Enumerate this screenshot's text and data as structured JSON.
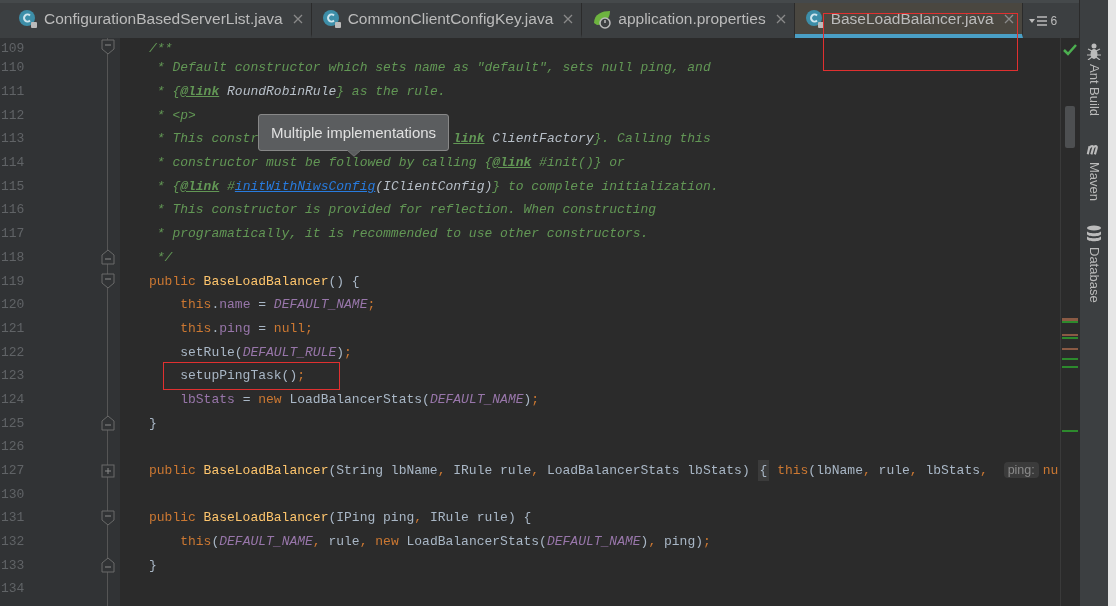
{
  "tabs": [
    {
      "label": "ConfigurationBasedServerList.java",
      "kind": "class",
      "selected": false
    },
    {
      "label": "CommonClientConfigKey.java",
      "kind": "class",
      "selected": false
    },
    {
      "label": "application.properties",
      "kind": "spring",
      "selected": false
    },
    {
      "label": "BaseLoadBalancer.java",
      "kind": "class",
      "selected": true
    }
  ],
  "tab_overflow": {
    "count": "6"
  },
  "tooltip": {
    "text": "Multiple implementations"
  },
  "code_lines": [
    {
      "number": "109",
      "kind": "fold_open",
      "tokens": [
        {
          "kind": "comment",
          "text": "/**"
        }
      ]
    },
    {
      "number": "110",
      "tokens": [
        {
          "kind": "comment",
          "text": " * Default constructor which sets name as \"default\", sets null ping, and"
        }
      ]
    },
    {
      "number": "111",
      "tokens": [
        {
          "kind": "comment",
          "text": " * {"
        },
        {
          "kind": "tag",
          "text": "@link"
        },
        {
          "kind": "ref",
          "text": " RoundRobinRule"
        },
        {
          "kind": "comment",
          "text": "} as the rule."
        }
      ]
    },
    {
      "number": "112",
      "tokens": [
        {
          "kind": "comment",
          "text": " * <p>"
        }
      ]
    },
    {
      "number": "113",
      "tokens": [
        {
          "kind": "comment",
          "text": " * This constr"
        },
        {
          "kind": "covered"
        },
        {
          "kind": "tag",
          "text": "link"
        },
        {
          "kind": "ref",
          "text": " ClientFactory"
        },
        {
          "kind": "comment",
          "text": "}. Calling this"
        }
      ]
    },
    {
      "number": "114",
      "tokens": [
        {
          "kind": "comment",
          "text": " * constructor must be followed by calling {"
        },
        {
          "kind": "tag",
          "text": "@link"
        },
        {
          "kind": "comment",
          "text": " #init()} or"
        }
      ]
    },
    {
      "number": "115",
      "tokens": [
        {
          "kind": "comment",
          "text": " * {"
        },
        {
          "kind": "tag",
          "text": "@link"
        },
        {
          "kind": "comment",
          "text": " #"
        },
        {
          "kind": "link",
          "text": "initWithNiwsConfig"
        },
        {
          "kind": "ref",
          "text": "(IClientConfig)"
        },
        {
          "kind": "comment",
          "text": "} to complete initialization."
        }
      ]
    },
    {
      "number": "116",
      "tokens": [
        {
          "kind": "comment",
          "text": " * This constructor is provided for reflection. When constructing"
        }
      ]
    },
    {
      "number": "117",
      "tokens": [
        {
          "kind": "comment",
          "text": " * programatically, it is recommended to use other constructors."
        }
      ]
    },
    {
      "number": "118",
      "kind": "fold_close",
      "tokens": [
        {
          "kind": "comment",
          "text": " */"
        }
      ]
    },
    {
      "number": "119",
      "kind": "fold_open",
      "tokens": [
        {
          "kind": "keyword",
          "text": "public "
        },
        {
          "kind": "method",
          "text": "BaseLoadBalancer"
        },
        {
          "kind": "plain",
          "text": "() {"
        }
      ]
    },
    {
      "number": "120",
      "tokens": [
        {
          "kind": "keyword",
          "text": "    this"
        },
        {
          "kind": "plain",
          "text": "."
        },
        {
          "kind": "field",
          "text": "name"
        },
        {
          "kind": "plain",
          "text": " = "
        },
        {
          "kind": "const",
          "text": "DEFAULT_NAME"
        },
        {
          "kind": "keyword",
          "text": ";"
        }
      ]
    },
    {
      "number": "121",
      "tokens": [
        {
          "kind": "keyword",
          "text": "    this"
        },
        {
          "kind": "plain",
          "text": "."
        },
        {
          "kind": "field",
          "text": "ping"
        },
        {
          "kind": "plain",
          "text": " = "
        },
        {
          "kind": "keyword",
          "text": "null;"
        }
      ]
    },
    {
      "number": "122",
      "tokens": [
        {
          "kind": "plain",
          "text": "    setRule("
        },
        {
          "kind": "const",
          "text": "DEFAULT_RULE"
        },
        {
          "kind": "plain",
          "text": ")"
        },
        {
          "kind": "keyword",
          "text": ";"
        }
      ]
    },
    {
      "number": "123",
      "tokens": [
        {
          "kind": "plain",
          "text": "    setupPingTask()"
        },
        {
          "kind": "keyword",
          "text": ";"
        }
      ]
    },
    {
      "number": "124",
      "tokens": [
        {
          "kind": "field",
          "text": "    lbStats"
        },
        {
          "kind": "plain",
          "text": " = "
        },
        {
          "kind": "keyword",
          "text": "new "
        },
        {
          "kind": "plain",
          "text": "LoadBalancerStats("
        },
        {
          "kind": "const",
          "text": "DEFAULT_NAME"
        },
        {
          "kind": "plain",
          "text": ")"
        },
        {
          "kind": "keyword",
          "text": ";"
        }
      ]
    },
    {
      "number": "125",
      "kind": "fold_close",
      "tokens": [
        {
          "kind": "plain",
          "text": "}"
        }
      ]
    },
    {
      "number": "126"
    },
    {
      "number": "127",
      "kind": "fold_collapsed",
      "tokens": [
        {
          "kind": "keyword",
          "text": "public "
        },
        {
          "kind": "method",
          "text": "BaseLoadBalancer"
        },
        {
          "kind": "plain",
          "text": "(String lbName"
        },
        {
          "kind": "keyword",
          "text": ", "
        },
        {
          "kind": "plain",
          "text": "IRule rule"
        },
        {
          "kind": "keyword",
          "text": ", "
        },
        {
          "kind": "plain",
          "text": "LoadBalancerStats lbStats) "
        },
        {
          "kind": "brace",
          "text": "{"
        },
        {
          "kind": "keyword",
          "text": " this"
        },
        {
          "kind": "plain",
          "text": "(lbName"
        },
        {
          "kind": "keyword",
          "text": ", "
        },
        {
          "kind": "plain",
          "text": "rule"
        },
        {
          "kind": "keyword",
          "text": ", "
        },
        {
          "kind": "plain",
          "text": "lbStats"
        },
        {
          "kind": "keyword",
          "text": ", "
        },
        {
          "kind": "hint",
          "text": "ping:"
        },
        {
          "kind": "keyword",
          "text": "nu"
        }
      ]
    },
    {
      "number": "130"
    },
    {
      "number": "131",
      "kind": "fold_open",
      "tokens": [
        {
          "kind": "keyword",
          "text": "public "
        },
        {
          "kind": "method",
          "text": "BaseLoadBalancer"
        },
        {
          "kind": "plain",
          "text": "(IPing ping"
        },
        {
          "kind": "keyword",
          "text": ", "
        },
        {
          "kind": "plain",
          "text": "IRule rule) {"
        }
      ]
    },
    {
      "number": "132",
      "tokens": [
        {
          "kind": "keyword",
          "text": "    this"
        },
        {
          "kind": "plain",
          "text": "("
        },
        {
          "kind": "const",
          "text": "DEFAULT_NAME"
        },
        {
          "kind": "keyword",
          "text": ", "
        },
        {
          "kind": "plain",
          "text": "rule"
        },
        {
          "kind": "keyword",
          "text": ", new "
        },
        {
          "kind": "plain",
          "text": "LoadBalancerStats("
        },
        {
          "kind": "const",
          "text": "DEFAULT_NAME"
        },
        {
          "kind": "plain",
          "text": ")"
        },
        {
          "kind": "keyword",
          "text": ", "
        },
        {
          "kind": "plain",
          "text": "ping)"
        },
        {
          "kind": "keyword",
          "text": ";"
        }
      ]
    },
    {
      "number": "133",
      "kind": "fold_close",
      "tokens": [
        {
          "kind": "plain",
          "text": "}"
        }
      ]
    },
    {
      "number": "134"
    }
  ],
  "tool_windows": [
    {
      "label": "Ant Build",
      "kind": "ant"
    },
    {
      "label": "Maven",
      "kind": "maven"
    },
    {
      "label": "Database",
      "kind": "database"
    }
  ]
}
